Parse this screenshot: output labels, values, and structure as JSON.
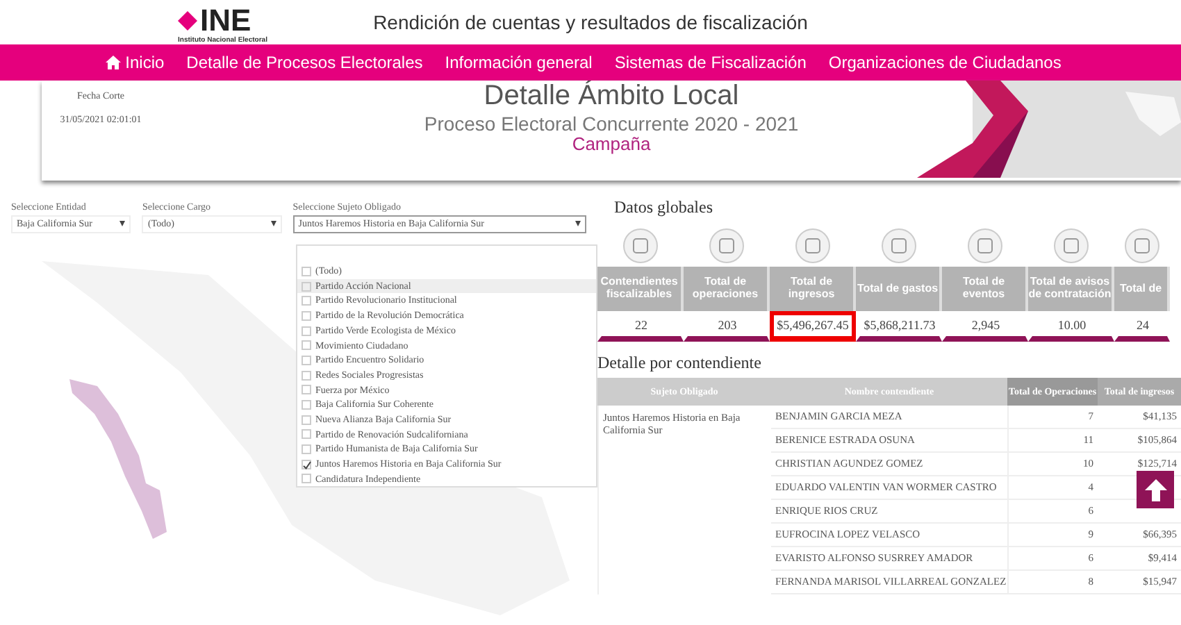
{
  "header": {
    "logo": "INE",
    "logo_subtitle": "Instituto Nacional Electoral",
    "title": "Rendición de cuentas y resultados de fiscalización"
  },
  "nav": [
    {
      "label": "Inicio",
      "kind": "home"
    },
    {
      "label": "Detalle de Procesos Electorales",
      "kind": "link"
    },
    {
      "label": "Información general",
      "kind": "link"
    },
    {
      "label": "Sistemas de Fiscalización",
      "kind": "link"
    },
    {
      "label": "Organizaciones de Ciudadanos",
      "kind": "link"
    }
  ],
  "banner": {
    "cut_date_label": "Fecha Corte",
    "cut_date": "31/05/2021 02:01:01",
    "title": "Detalle Ámbito Local",
    "subtitle": "Proceso Electoral Concurrente 2020 - 2021",
    "stage": "Campaña"
  },
  "filters": [
    {
      "label": "Seleccione Entidad",
      "value": "Baja California Sur",
      "open": false
    },
    {
      "label": "Seleccione Cargo",
      "value": "(Todo)",
      "open": false
    },
    {
      "label": "Seleccione Sujeto Obligado",
      "value": "Juntos Haremos Historia en Baja California Sur",
      "open": true
    }
  ],
  "subject_options": [
    {
      "label": "(Todo)",
      "checked": false,
      "highlighted": false
    },
    {
      "label": "Partido Acción Nacional",
      "checked": false,
      "highlighted": true
    },
    {
      "label": "Partido Revolucionario Institucional",
      "checked": false,
      "highlighted": false
    },
    {
      "label": "Partido de la Revolución Democrática",
      "checked": false,
      "highlighted": false
    },
    {
      "label": "Partido Verde Ecologista de México",
      "checked": false,
      "highlighted": false
    },
    {
      "label": "Movimiento Ciudadano",
      "checked": false,
      "highlighted": false
    },
    {
      "label": "Partido Encuentro Solidario",
      "checked": false,
      "highlighted": false
    },
    {
      "label": "Redes Sociales Progresistas",
      "checked": false,
      "highlighted": false
    },
    {
      "label": "Fuerza por México",
      "checked": false,
      "highlighted": false
    },
    {
      "label": "Baja California Sur Coherente",
      "checked": false,
      "highlighted": false
    },
    {
      "label": "Nueva Alianza Baja California Sur",
      "checked": false,
      "highlighted": false
    },
    {
      "label": "Partido de Renovación Sudcaliforniana",
      "checked": false,
      "highlighted": false
    },
    {
      "label": "Partido Humanista de Baja California Sur",
      "checked": false,
      "highlighted": false
    },
    {
      "label": "Juntos Haremos Historia en Baja California Sur",
      "checked": true,
      "highlighted": false
    },
    {
      "label": "Candidatura Independiente",
      "checked": false,
      "highlighted": false
    }
  ],
  "global_data": {
    "title": "Datos globales",
    "columns": [
      {
        "heading": "Contendientes fiscalizables",
        "value": "22",
        "highlighted": false
      },
      {
        "heading": "Total de operaciones",
        "value": "203",
        "highlighted": false
      },
      {
        "heading": "Total de ingresos",
        "value": "$5,496,267.45",
        "highlighted": true
      },
      {
        "heading": "Total de gastos",
        "value": "$5,868,211.73",
        "highlighted": false
      },
      {
        "heading": "Total de eventos",
        "value": "2,945",
        "highlighted": false
      },
      {
        "heading": "Total de avisos de contratación",
        "value": "10.00",
        "highlighted": false
      },
      {
        "heading": "Total de",
        "value": "24",
        "highlighted": false
      }
    ]
  },
  "contenders": {
    "title": "Detalle por contendiente",
    "columns": [
      "Sujeto Obligado",
      "Nombre contendiente",
      "Total de Operaciones",
      "Total de ingresos"
    ],
    "subject": "Juntos Haremos Historia en Baja California Sur",
    "rows": [
      {
        "name": "BENJAMIN GARCIA MEZA",
        "operations": "7",
        "income": "$41,135"
      },
      {
        "name": "BERENICE ESTRADA OSUNA",
        "operations": "11",
        "income": "$105,864"
      },
      {
        "name": "CHRISTIAN AGUNDEZ GOMEZ",
        "operations": "10",
        "income": "$125,714"
      },
      {
        "name": "EDUARDO VALENTIN VAN WORMER CASTRO",
        "operations": "4"
      },
      {
        "name": "ENRIQUE RIOS CRUZ",
        "operations": "6"
      },
      {
        "name": "EUFROCINA LOPEZ VELASCO",
        "operations": "9",
        "income": "$66,395"
      },
      {
        "name": "EVARISTO ALFONSO SUSRREY AMADOR",
        "operations": "6",
        "income": "$9,414"
      },
      {
        "name": "FERNANDA MARISOL VILLARREAL GONZALEZ",
        "operations": "8",
        "income": "$15,947"
      }
    ]
  }
}
